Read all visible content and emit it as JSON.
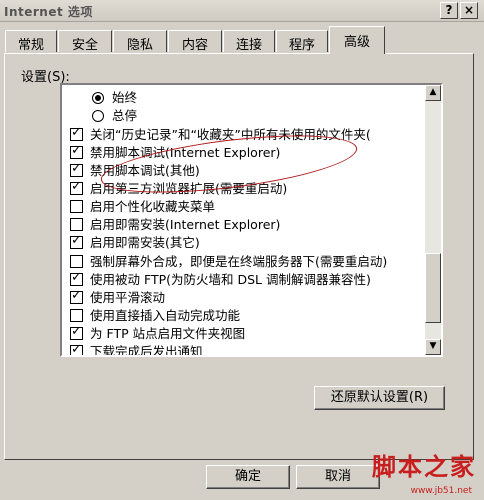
{
  "window": {
    "title": "Internet 选项",
    "help_label": "?",
    "close_label": "×"
  },
  "tabs": [
    {
      "label": "常规"
    },
    {
      "label": "安全"
    },
    {
      "label": "隐私"
    },
    {
      "label": "内容"
    },
    {
      "label": "连接"
    },
    {
      "label": "程序"
    },
    {
      "label": "高级",
      "active": true
    }
  ],
  "settings": {
    "label": "设置(S):",
    "items": [
      {
        "type": "radio",
        "checked": true,
        "label": "始终"
      },
      {
        "type": "radio",
        "checked": false,
        "label": "总停"
      },
      {
        "type": "checkbox",
        "checked": true,
        "label": "关闭“历史记录”和“收藏夹”中所有未使用的文件夹("
      },
      {
        "type": "checkbox",
        "checked": true,
        "label": "禁用脚本调试(Internet Explorer)"
      },
      {
        "type": "checkbox",
        "checked": true,
        "label": "禁用脚本调试(其他)"
      },
      {
        "type": "checkbox",
        "checked": true,
        "label": "启用第三方浏览器扩展(需要重启动)"
      },
      {
        "type": "checkbox",
        "checked": false,
        "label": "启用个性化收藏夹菜单"
      },
      {
        "type": "checkbox",
        "checked": false,
        "label": "启用即需安装(Internet Explorer)"
      },
      {
        "type": "checkbox",
        "checked": true,
        "label": "启用即需安装(其它)"
      },
      {
        "type": "checkbox",
        "checked": false,
        "label": "强制屏幕外合成，即便是在终端服务器下(需要重启动)"
      },
      {
        "type": "checkbox",
        "checked": true,
        "label": "使用被动 FTP(为防火墙和 DSL 调制解调器兼容性)"
      },
      {
        "type": "checkbox",
        "checked": true,
        "label": "使用平滑滚动"
      },
      {
        "type": "checkbox",
        "checked": false,
        "label": "使用直接插入自动完成功能"
      },
      {
        "type": "checkbox",
        "checked": true,
        "label": "为 FTP 站点启用文件夹视图"
      },
      {
        "type": "checkbox",
        "checked": true,
        "label": "下载完成后发出通知"
      }
    ]
  },
  "scrollbar": {
    "up_arrow": "▲",
    "down_arrow": "▼"
  },
  "buttons": {
    "restore_defaults": "还原默认设置(R)",
    "ok": "确定",
    "cancel": "取消"
  },
  "watermark": {
    "brand": "脚本之家",
    "url": "www.jb51.net"
  },
  "colors": {
    "window_bg": "#d4d0c8",
    "annotation": "#b01818",
    "watermark": "#c81e1e"
  }
}
